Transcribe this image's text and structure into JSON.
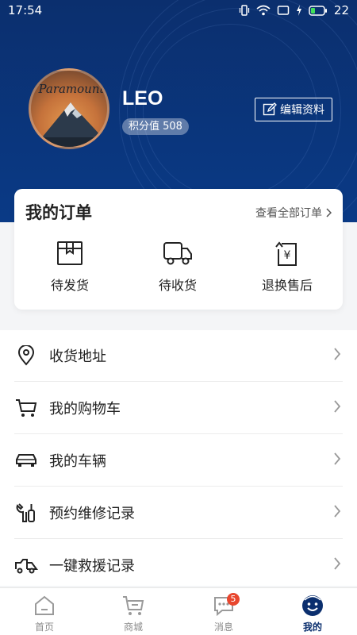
{
  "status": {
    "time": "17:54",
    "battery": "22"
  },
  "profile": {
    "name": "LEO",
    "points_label": "积分值 508",
    "edit_label": "编辑资料",
    "avatar_text": "Paramount"
  },
  "orders": {
    "title": "我的订单",
    "view_all": "查看全部订单",
    "items": [
      {
        "label": "待发货",
        "icon": "package-icon"
      },
      {
        "label": "待收货",
        "icon": "truck-icon"
      },
      {
        "label": "退换售后",
        "icon": "refund-icon"
      }
    ]
  },
  "menu": [
    {
      "label": "收货地址",
      "icon": "location-icon"
    },
    {
      "label": "我的购物车",
      "icon": "cart-icon"
    },
    {
      "label": "我的车辆",
      "icon": "car-icon"
    },
    {
      "label": "预约维修记录",
      "icon": "repair-icon"
    },
    {
      "label": "一键救援记录",
      "icon": "tow-truck-icon"
    }
  ],
  "tabs": [
    {
      "label": "首页",
      "icon": "home-icon"
    },
    {
      "label": "商城",
      "icon": "shop-cart-icon"
    },
    {
      "label": "消息",
      "icon": "message-icon",
      "badge": "5"
    },
    {
      "label": "我的",
      "icon": "profile-icon"
    }
  ],
  "colors": {
    "primary": "#0b2f6e",
    "badge": "#e8472f"
  }
}
